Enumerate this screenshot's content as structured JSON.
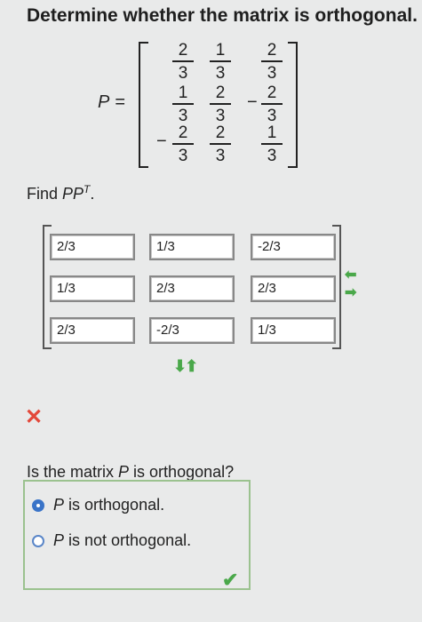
{
  "title": "Determine whether the matrix is orthogonal.",
  "matrix_p": {
    "label": "P",
    "equals": "=",
    "rows": [
      [
        {
          "sign": "",
          "num": "2",
          "den": "3"
        },
        {
          "sign": "",
          "num": "1",
          "den": "3"
        },
        {
          "sign": "",
          "num": "2",
          "den": "3"
        }
      ],
      [
        {
          "sign": "",
          "num": "1",
          "den": "3"
        },
        {
          "sign": "",
          "num": "2",
          "den": "3"
        },
        {
          "sign": "−",
          "num": "2",
          "den": "3"
        }
      ],
      [
        {
          "sign": "−",
          "num": "2",
          "den": "3"
        },
        {
          "sign": "",
          "num": "2",
          "den": "3"
        },
        {
          "sign": "",
          "num": "1",
          "den": "3"
        }
      ]
    ]
  },
  "find_prompt": {
    "prefix": "Find ",
    "expr": "PP",
    "sup": "T",
    "suffix": "."
  },
  "answer_matrix": [
    [
      "2/3",
      "1/3",
      "-2/3"
    ],
    [
      "1/3",
      "2/3",
      "2/3"
    ],
    [
      "2/3",
      "-2/3",
      "1/3"
    ]
  ],
  "status": {
    "matrix_result": "incorrect",
    "x_mark": "✕",
    "check_mark": "✔"
  },
  "question": {
    "prefix": "Is the matrix ",
    "var": "P",
    "suffix": " is orthogonal?"
  },
  "options": [
    {
      "var": "P",
      "text": " is orthogonal.",
      "selected": true
    },
    {
      "var": "P",
      "text": " is not orthogonal.",
      "selected": false
    }
  ],
  "colors": {
    "accent": "#3a74c8",
    "correct": "#4aa84a",
    "wrong": "#e3483a"
  }
}
